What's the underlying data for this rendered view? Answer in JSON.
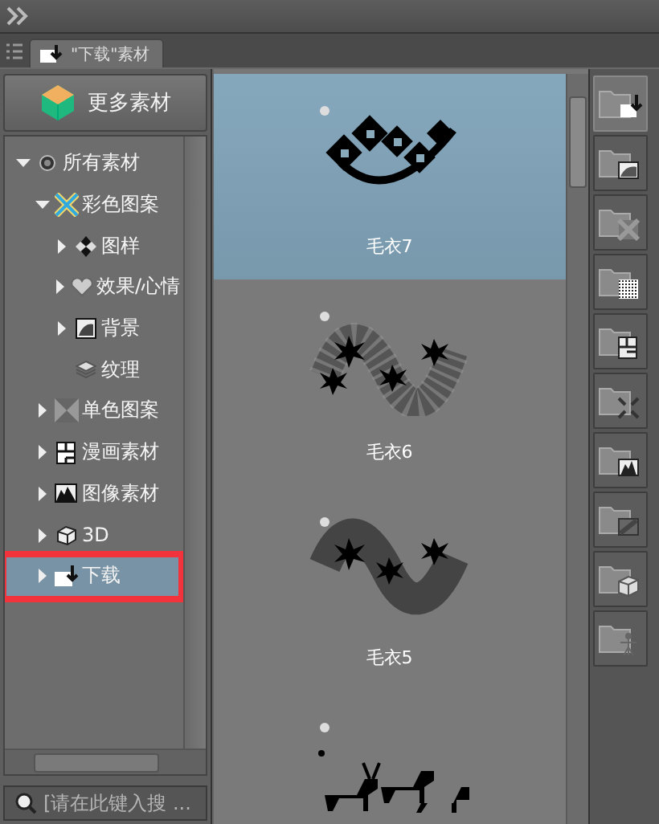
{
  "panel_tab": {
    "label": "\"下载\"素材",
    "selected": true
  },
  "more_button": {
    "label": "更多素材"
  },
  "tree": [
    {
      "label": "所有素材",
      "kind": "branch",
      "expanded": true,
      "selected": false,
      "highlighted": false,
      "children": [
        {
          "label": "彩色图案",
          "kind": "branch",
          "expanded": true,
          "selected": false,
          "highlighted": false,
          "children": [
            {
              "label": "图样",
              "kind": "branch",
              "expanded": false,
              "selected": false,
              "highlighted": false
            },
            {
              "label": "效果/心情",
              "kind": "branch",
              "expanded": false,
              "selected": false,
              "highlighted": false
            },
            {
              "label": "背景",
              "kind": "branch",
              "expanded": false,
              "selected": false,
              "highlighted": false
            },
            {
              "label": "纹理",
              "kind": "leaf",
              "selected": false,
              "highlighted": false
            }
          ]
        },
        {
          "label": "单色图案",
          "kind": "branch",
          "expanded": false,
          "selected": false,
          "highlighted": false
        },
        {
          "label": "漫画素材",
          "kind": "branch",
          "expanded": false,
          "selected": false,
          "highlighted": false
        },
        {
          "label": "图像素材",
          "kind": "branch",
          "expanded": false,
          "selected": false,
          "highlighted": false
        },
        {
          "label": "3D",
          "kind": "branch",
          "expanded": false,
          "selected": false,
          "highlighted": false
        },
        {
          "label": "下载",
          "kind": "branch",
          "expanded": false,
          "selected": true,
          "highlighted": true
        }
      ]
    }
  ],
  "search": {
    "placeholder": "[请在此键入搜 ..."
  },
  "materials": [
    {
      "label": "毛衣7",
      "selected": true
    },
    {
      "label": "毛衣6",
      "selected": false
    },
    {
      "label": "毛衣5",
      "selected": false
    },
    {
      "selected": false
    }
  ],
  "rail_buttons": [
    {
      "selected": true
    },
    {
      "selected": false
    },
    {
      "selected": false
    },
    {
      "selected": false
    },
    {
      "selected": false
    },
    {
      "selected": false
    },
    {
      "selected": false
    },
    {
      "selected": false
    },
    {
      "selected": false
    },
    {
      "selected": false
    }
  ]
}
